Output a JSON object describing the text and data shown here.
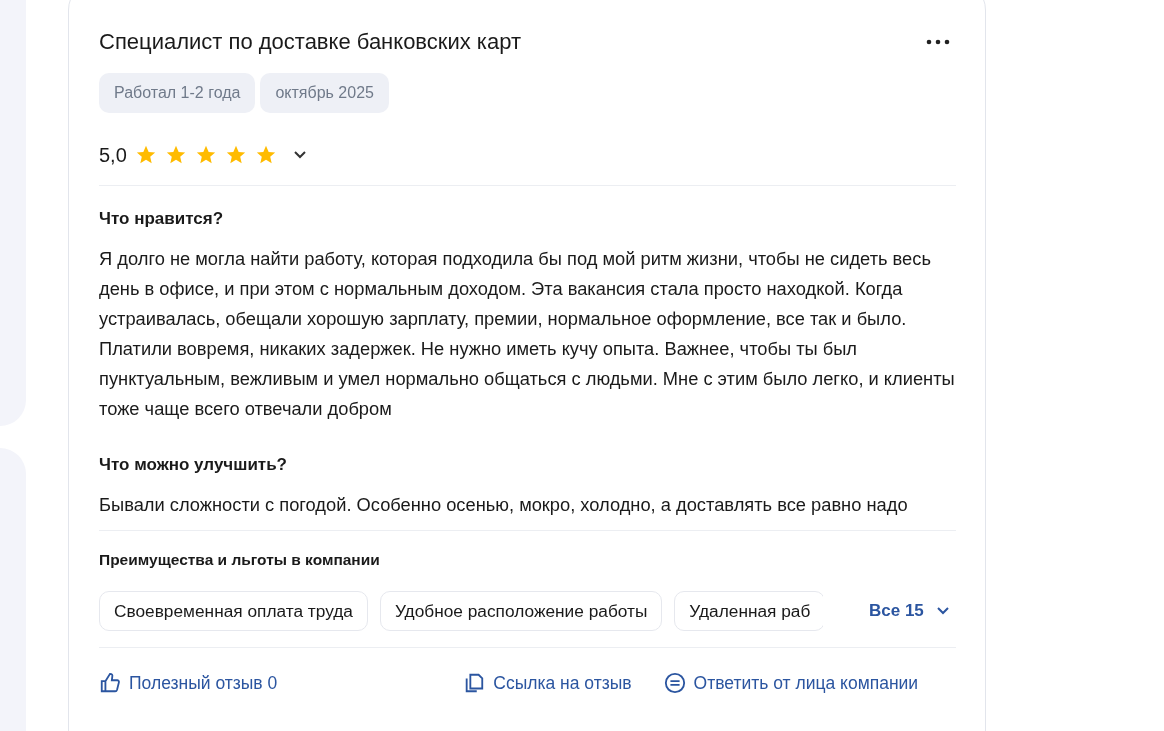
{
  "review": {
    "title": "Специалист по доставке банковских карт",
    "tags": [
      "Работал 1-2 года",
      "октябрь 2025"
    ],
    "rating": "5,0",
    "stars": 5,
    "sections": [
      {
        "heading": "Что нравится?",
        "text": "Я долго не могла найти работу, которая подходила бы под мой ритм жизни, чтобы не сидеть весь день в офисе, и при этом с нормальным доходом. Эта вакансия стала просто находкой. Когда устраивалась, обещали хорошую зарплату, премии, нормальное оформление, все так и было. Платили вовремя, никаких задержек. Не нужно иметь кучу опыта. Важнее, чтобы ты был пунктуальным, вежливым и умел нормально общаться с людьми. Мне с этим было легко, и клиенты тоже чаще всего отвечали добром"
      },
      {
        "heading": "Что можно улучшить?",
        "text": "Бывали сложности с погодой. Особенно осенью, мокро, холодно, а доставлять все равно надо"
      }
    ],
    "benefits": {
      "heading": "Преимущества и льготы в компании",
      "items": [
        "Своевременная оплата труда",
        "Удобное расположение работы",
        "Удаленная раб"
      ],
      "more": "Все 15"
    },
    "actions": [
      {
        "kind": "like",
        "label": "Полезный отзыв 0"
      },
      {
        "kind": "link",
        "label": "Ссылка на отзыв"
      },
      {
        "kind": "reply",
        "label": "Ответить от лица компании"
      }
    ]
  }
}
